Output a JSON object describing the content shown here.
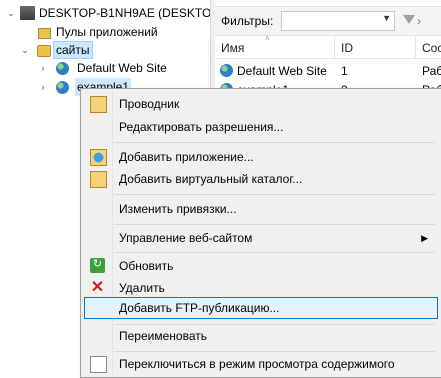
{
  "tree": {
    "server": "DESKTOP-B1NH9AE (DESKTOP",
    "app_pools": "Пулы приложений",
    "sites": "сайты",
    "default_site": "Default Web Site",
    "example_site": "example1"
  },
  "right": {
    "filter_label": "Фильтры:",
    "columns": {
      "name": "Имя",
      "id": "ID",
      "status": "Сос"
    },
    "rows": [
      {
        "name": "Default Web Site",
        "id": "1",
        "status": "Раб"
      },
      {
        "name": "example1",
        "id": "2",
        "status": "Раб"
      }
    ]
  },
  "menu": {
    "items": [
      {
        "label": "Проводник",
        "icon": "explorer-icon"
      },
      {
        "label": "Редактировать разрешения..."
      },
      {
        "label": "Добавить приложение...",
        "icon": "add-application-icon"
      },
      {
        "label": "Добавить виртуальный каталог...",
        "icon": "add-virtual-directory-icon"
      },
      {
        "label": "Изменить привязки..."
      },
      {
        "label": "Управление веб-сайтом",
        "submenu": true
      },
      {
        "label": "Обновить",
        "icon": "refresh-icon"
      },
      {
        "label": "Удалить",
        "icon": "delete-icon"
      },
      {
        "label": "Добавить FTP-публикацию..."
      },
      {
        "label": "Переименовать"
      },
      {
        "label": "Переключиться в режим просмотра содержимого",
        "icon": "content-view-icon"
      }
    ]
  },
  "colors": {
    "selection": "#cce8ff",
    "menu_hover": "#e5f1fb",
    "menu_hover_border": "#0078d7",
    "delete_icon": "#d41b1b"
  }
}
